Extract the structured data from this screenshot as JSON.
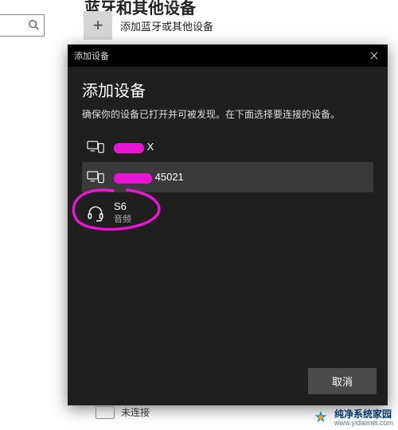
{
  "bg": {
    "header_partial": "蓝牙和其他设备",
    "add_label": "添加蓝牙或其他设备",
    "not_connected": "未连接"
  },
  "dialog": {
    "titlebar": "添加设备",
    "heading": "添加设备",
    "subtitle": "确保你的设备已打开并可被发现。在下面选择要连接的设备。",
    "devices": [
      {
        "name": "X",
        "sub": "",
        "type": "display",
        "redacted": true
      },
      {
        "name": "45021",
        "sub": "",
        "type": "display",
        "redacted": true,
        "selected": true
      },
      {
        "name": "S6",
        "sub": "音频",
        "type": "headset"
      }
    ],
    "cancel": "取消"
  },
  "watermark": {
    "line1": "纯净系统家园",
    "line2": "www.yidaimei.com"
  }
}
